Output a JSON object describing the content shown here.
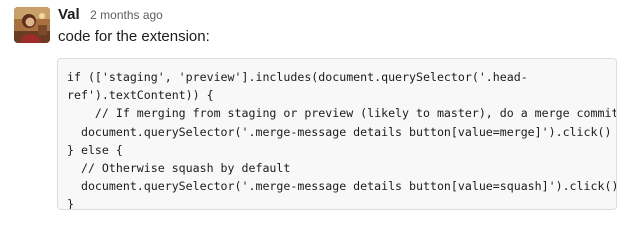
{
  "message": {
    "sender": "Val",
    "timestamp": "2 months ago",
    "text": "code for the extension:",
    "avatar_icon": "user-avatar",
    "code_lines": [
      "if (['staging', 'preview'].includes(document.querySelector('.head-",
      "ref').textContent)) {",
      "    // If merging from staging or preview (likely to master), do a merge commit",
      "  document.querySelector('.merge-message details button[value=merge]').click()",
      "} else {",
      "  // Otherwise squash by default",
      "  document.querySelector('.merge-message details button[value=squash]').click()",
      "}"
    ]
  },
  "colors": {
    "code_background": "#f8f8f8",
    "code_border": "#dddddd",
    "timestamp": "#616061",
    "text": "#1d1c1d"
  }
}
